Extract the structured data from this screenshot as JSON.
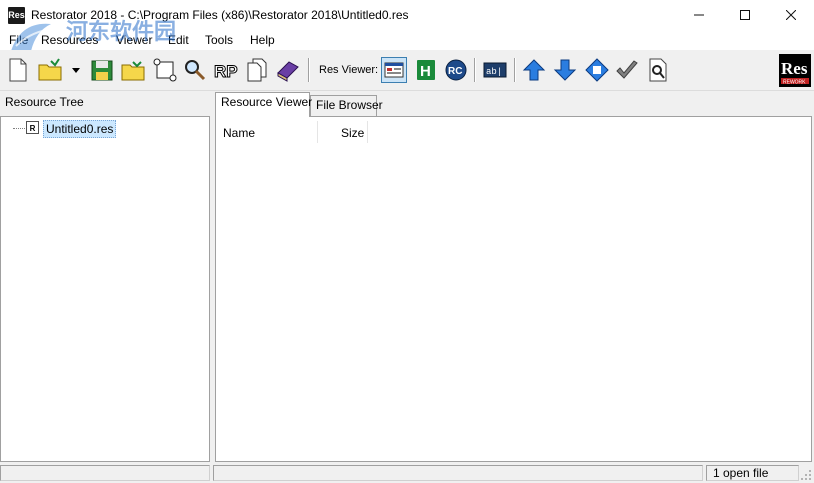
{
  "window": {
    "app_icon": "Res",
    "title": "Restorator 2018 - C:\\Program Files (x86)\\Restorator 2018\\Untitled0.res",
    "minimize_icon": "minimize-icon",
    "maximize_icon": "maximize-icon",
    "close_icon": "close-icon"
  },
  "menu": {
    "items": [
      "File",
      "Resources",
      "Viewer",
      "Edit",
      "Tools",
      "Help"
    ]
  },
  "watermark": {
    "main": "河东软件园",
    "sub": "www.pc0359.cn"
  },
  "toolbar": {
    "buttons": [
      {
        "name": "new-file-icon"
      },
      {
        "name": "open-folder-icon"
      },
      {
        "name": "dropdown-arrow-icon"
      },
      {
        "name": "save-icon"
      },
      {
        "name": "open-resource-folder-icon"
      },
      {
        "name": "scroll-icon"
      },
      {
        "name": "find-icon"
      },
      {
        "name": "rp-icon",
        "label": "RP"
      },
      {
        "name": "copy-pages-icon"
      },
      {
        "name": "book-icon"
      }
    ],
    "res_viewer_label": "Res Viewer:",
    "viewer_buttons": [
      {
        "name": "window-view-icon"
      },
      {
        "name": "hex-view-icon",
        "label": "H"
      },
      {
        "name": "rc-view-icon",
        "label": "RC"
      },
      {
        "name": "text-view-icon",
        "label": "ab|"
      }
    ],
    "nav_buttons": [
      {
        "name": "arrow-up-icon"
      },
      {
        "name": "arrow-down-icon"
      },
      {
        "name": "move-icon"
      },
      {
        "name": "checkmark-icon"
      },
      {
        "name": "document-search-icon"
      }
    ],
    "logo_text": "Res",
    "logo_sub": "REWORK"
  },
  "left": {
    "header": "Resource Tree",
    "tree": [
      {
        "icon": "R",
        "label": "Untitled0.res"
      }
    ]
  },
  "right": {
    "tabs": [
      {
        "label": "Resource Viewer",
        "active": true
      },
      {
        "label": "File Browser",
        "active": false
      }
    ],
    "columns": [
      "Name",
      "Size"
    ]
  },
  "status": {
    "text": "1 open file"
  },
  "colors": {
    "selection": "#cce8ff",
    "toolbar_active": "#cce4f7",
    "arrow_blue": "#1e6fd0",
    "hex_green": "#1a8a3a"
  }
}
